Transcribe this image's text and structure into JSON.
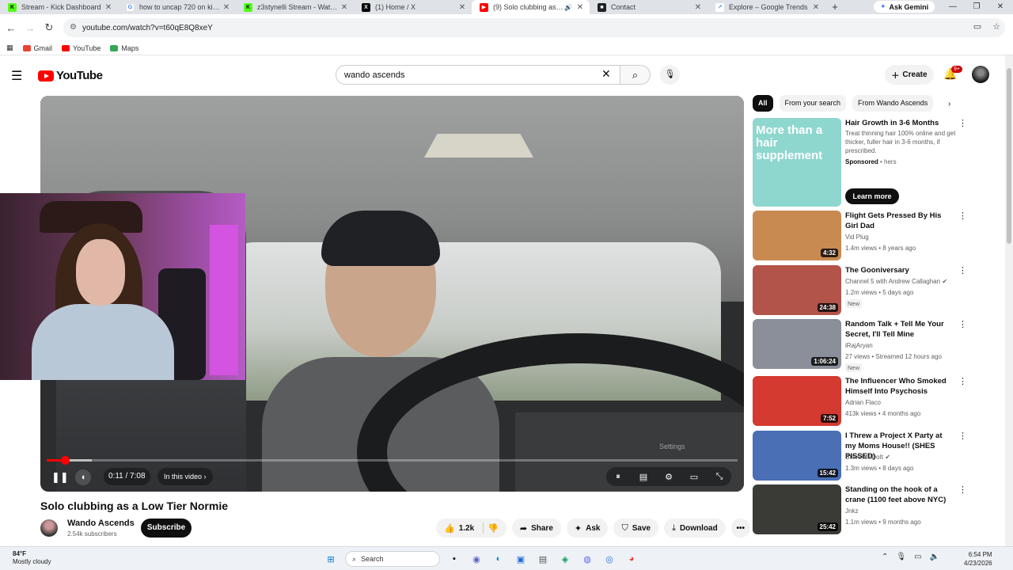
{
  "browser": {
    "tabs": [
      {
        "title": "Stream - Kick Dashboard",
        "icon": "kick-icon",
        "color": "#53fc18"
      },
      {
        "title": "how to uncap 720 on kick st",
        "icon": "google-icon",
        "color": "#4285f4"
      },
      {
        "title": "z3stynelli Stream - Watch Li",
        "icon": "kick-icon",
        "color": "#53fc18"
      },
      {
        "title": "(1) Home / X",
        "icon": "x-icon",
        "color": "#000000"
      },
      {
        "title": "(9) Solo clubbing as a Lo",
        "icon": "youtube-icon",
        "color": "#ff0000"
      },
      {
        "title": "Contact",
        "icon": "page-icon",
        "color": "#202124"
      },
      {
        "title": "Explore – Google Trends",
        "icon": "trends-icon",
        "color": "#4285f4"
      }
    ],
    "gemini_label": "Ask Gemini",
    "url": "youtube.com/watch?v=t60qE8Q8xeY",
    "bookmarks": [
      {
        "label": "Gmail",
        "color": "#ea4335"
      },
      {
        "label": "YouTube",
        "color": "#ff0000"
      },
      {
        "label": "Maps",
        "color": "#34a853"
      }
    ]
  },
  "youtube": {
    "logo_text": "YouTube",
    "search_value": "wando ascends",
    "create_label": "Create",
    "notif_badge": "9+"
  },
  "player": {
    "current_time": "0:11",
    "duration": "7:08",
    "time_display": "0:11 / 7:08",
    "chapter_label": "In this video",
    "watermark": "Settings",
    "progress_fraction": 0.026,
    "buffered_fraction": 0.065
  },
  "video": {
    "title": "Solo clubbing as a Low Tier Normie",
    "channel": "Wando Ascends",
    "subscribers": "2.54k subscribers",
    "subscribe_label": "Subscribe",
    "likes": "1.2k",
    "share_label": "Share",
    "ask_label": "Ask",
    "save_label": "Save",
    "download_label": "Download"
  },
  "sidebar": {
    "chips": [
      "All",
      "From your search",
      "From Wando Ascends"
    ],
    "ad": {
      "thumb_text": "More than a hair supplement",
      "title": "Hair Growth in 3-6 Months",
      "desc": "Treat thinning hair 100% online and get thicker, fuller hair in 3-6 months, if prescribed.",
      "sponsored": "Sponsored",
      "advertiser": "hers",
      "cta": "Learn more"
    },
    "videos": [
      {
        "title": "Flight Gets Pressed By His Girl Dad",
        "channel": "Vid Plug",
        "meta": "1.4m views • 8 years ago",
        "duration": "4:32",
        "new": "",
        "color": "#c98a52"
      },
      {
        "title": "The Gooniversary",
        "channel": "Channel 5 with Andrew Callaghan",
        "meta": "1.2m views • 5 days ago",
        "duration": "24:38",
        "new": "New",
        "color": "#b3544a"
      },
      {
        "title": "Random Talk + Tell Me Your Secret, I'll Tell Mine",
        "channel": "iRajAryan",
        "meta": "27 views • Streamed 12 hours ago",
        "duration": "1:06:24",
        "new": "New",
        "color": "#8a8f99"
      },
      {
        "title": "The Influencer Who Smoked Himself Into Psychosis",
        "channel": "Adrian Flaco",
        "meta": "413k views • 4 months ago",
        "duration": "7:52",
        "new": "",
        "color": "#d43a2f"
      },
      {
        "title": "I Threw a Project X Party at my Moms House!! (SHES PISSED)",
        "channel": "SteveWillDoIt",
        "meta": "1.3m views • 8 days ago",
        "duration": "15:42",
        "new": "",
        "color": "#4a6fb5"
      },
      {
        "title": "Standing on the hook of a crane (1100 feet above NYC)",
        "channel": "Jnkz",
        "meta": "1.1m views • 9 months ago",
        "duration": "25:42",
        "new": "",
        "color": "#3a3b36"
      }
    ]
  },
  "taskbar": {
    "temp": "84°F",
    "weather": "Mostly cloudy",
    "search_label": "Search",
    "time": "6:54 PM",
    "date": "4/23/2026"
  }
}
